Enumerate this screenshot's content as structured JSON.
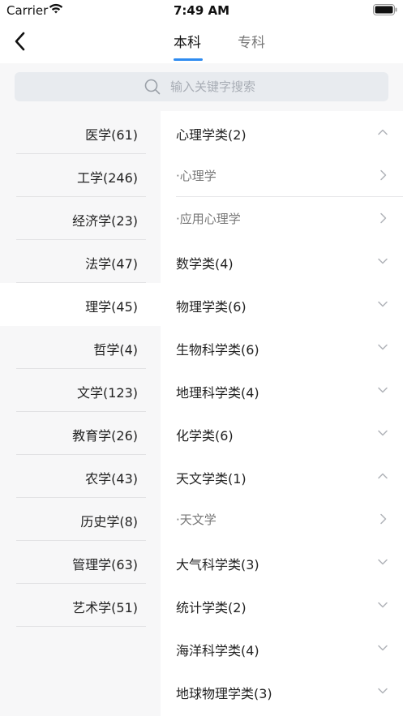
{
  "status": {
    "carrier": "Carrier",
    "time": "7:49 AM"
  },
  "nav": {
    "tabs": [
      {
        "label": "本科"
      },
      {
        "label": "专科"
      }
    ]
  },
  "search": {
    "placeholder": "输入关键字搜索",
    "value": ""
  },
  "categories": [
    {
      "label": "医学(61)"
    },
    {
      "label": "工学(246)"
    },
    {
      "label": "经济学(23)"
    },
    {
      "label": "法学(47)"
    },
    {
      "label": "理学(45)"
    },
    {
      "label": "哲学(4)"
    },
    {
      "label": "文学(123)"
    },
    {
      "label": "教育学(26)"
    },
    {
      "label": "农学(43)"
    },
    {
      "label": "历史学(8)"
    },
    {
      "label": "管理学(63)"
    },
    {
      "label": "艺术学(51)"
    }
  ],
  "rows": [
    {
      "label": "心理学类(2)",
      "icon": "chevron-up-icon"
    },
    {
      "label": "·心理学",
      "icon": "chevron-right-icon"
    },
    {
      "label": "·应用心理学",
      "icon": "chevron-right-icon"
    },
    {
      "label": "数学类(4)",
      "icon": "chevron-down-icon"
    },
    {
      "label": "物理学类(6)",
      "icon": "chevron-down-icon"
    },
    {
      "label": "生物科学类(6)",
      "icon": "chevron-down-icon"
    },
    {
      "label": "地理科学类(4)",
      "icon": "chevron-down-icon"
    },
    {
      "label": "化学类(6)",
      "icon": "chevron-down-icon"
    },
    {
      "label": "天文学类(1)",
      "icon": "chevron-up-icon"
    },
    {
      "label": "·天文学",
      "icon": "chevron-right-icon"
    },
    {
      "label": "大气科学类(3)",
      "icon": "chevron-down-icon"
    },
    {
      "label": "统计学类(2)",
      "icon": "chevron-down-icon"
    },
    {
      "label": "海洋科学类(4)",
      "icon": "chevron-down-icon"
    },
    {
      "label": "地球物理学类(3)",
      "icon": "chevron-down-icon"
    }
  ],
  "colors": {
    "accent": "#2e8bf0",
    "panel_bg": "#f7f7f8",
    "search_bg": "#e8ebef"
  }
}
